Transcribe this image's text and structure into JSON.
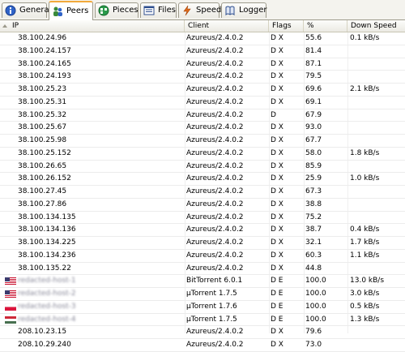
{
  "tabs": [
    {
      "label": "General",
      "icon": "info-icon"
    },
    {
      "label": "Peers",
      "icon": "peers-icon"
    },
    {
      "label": "Pieces",
      "icon": "pieces-icon"
    },
    {
      "label": "Files",
      "icon": "files-icon"
    },
    {
      "label": "Speed",
      "icon": "speed-icon"
    },
    {
      "label": "Logger",
      "icon": "logger-icon"
    }
  ],
  "active_tab": "Peers",
  "columns": {
    "ip": "IP",
    "client": "Client",
    "flags": "Flags",
    "pct": "%",
    "down": "Down Speed"
  },
  "peers": [
    {
      "ip": "38.100.24.96",
      "client": "Azureus/2.4.0.2",
      "flags": "D X",
      "pct": "55.6",
      "down": "0.1 kB/s"
    },
    {
      "ip": "38.100.24.157",
      "client": "Azureus/2.4.0.2",
      "flags": "D X",
      "pct": "81.4",
      "down": ""
    },
    {
      "ip": "38.100.24.165",
      "client": "Azureus/2.4.0.2",
      "flags": "D X",
      "pct": "87.1",
      "down": ""
    },
    {
      "ip": "38.100.24.193",
      "client": "Azureus/2.4.0.2",
      "flags": "D X",
      "pct": "79.5",
      "down": ""
    },
    {
      "ip": "38.100.25.23",
      "client": "Azureus/2.4.0.2",
      "flags": "D X",
      "pct": "69.6",
      "down": "2.1 kB/s"
    },
    {
      "ip": "38.100.25.31",
      "client": "Azureus/2.4.0.2",
      "flags": "D X",
      "pct": "69.1",
      "down": ""
    },
    {
      "ip": "38.100.25.32",
      "client": "Azureus/2.4.0.2",
      "flags": "D",
      "pct": "67.9",
      "down": ""
    },
    {
      "ip": "38.100.25.67",
      "client": "Azureus/2.4.0.2",
      "flags": "D X",
      "pct": "93.0",
      "down": ""
    },
    {
      "ip": "38.100.25.98",
      "client": "Azureus/2.4.0.2",
      "flags": "D X",
      "pct": "67.7",
      "down": ""
    },
    {
      "ip": "38.100.25.152",
      "client": "Azureus/2.4.0.2",
      "flags": "D X",
      "pct": "58.0",
      "down": "1.8 kB/s"
    },
    {
      "ip": "38.100.26.65",
      "client": "Azureus/2.4.0.2",
      "flags": "D X",
      "pct": "85.9",
      "down": ""
    },
    {
      "ip": "38.100.26.152",
      "client": "Azureus/2.4.0.2",
      "flags": "D X",
      "pct": "25.9",
      "down": "1.0 kB/s"
    },
    {
      "ip": "38.100.27.45",
      "client": "Azureus/2.4.0.2",
      "flags": "D X",
      "pct": "67.3",
      "down": ""
    },
    {
      "ip": "38.100.27.86",
      "client": "Azureus/2.4.0.2",
      "flags": "D X",
      "pct": "38.8",
      "down": ""
    },
    {
      "ip": "38.100.134.135",
      "client": "Azureus/2.4.0.2",
      "flags": "D X",
      "pct": "75.2",
      "down": ""
    },
    {
      "ip": "38.100.134.136",
      "client": "Azureus/2.4.0.2",
      "flags": "D X",
      "pct": "38.7",
      "down": "0.4 kB/s"
    },
    {
      "ip": "38.100.134.225",
      "client": "Azureus/2.4.0.2",
      "flags": "D X",
      "pct": "32.1",
      "down": "1.7 kB/s"
    },
    {
      "ip": "38.100.134.236",
      "client": "Azureus/2.4.0.2",
      "flags": "D X",
      "pct": "60.3",
      "down": "1.1 kB/s"
    },
    {
      "ip": "38.100.135.22",
      "client": "Azureus/2.4.0.2",
      "flags": "D X",
      "pct": "44.8",
      "down": ""
    },
    {
      "ip": "redacted-host-1",
      "client": "BitTorrent 6.0.1",
      "flags": "D E",
      "pct": "100.0",
      "down": "13.0 kB/s",
      "redacted": true,
      "flag": "us-flag-icon"
    },
    {
      "ip": "redacted-host-2",
      "client": "µTorrent 1.7.5",
      "flags": "D E",
      "pct": "100.0",
      "down": "3.0 kB/s",
      "redacted": true,
      "flag": "us-flag-icon"
    },
    {
      "ip": "redacted-host-3",
      "client": "µTorrent 1.7.6",
      "flags": "D E",
      "pct": "100.0",
      "down": "0.5 kB/s",
      "redacted": true,
      "flag": "pl-flag-icon"
    },
    {
      "ip": "redacted-host-4",
      "client": "µTorrent 1.7.5",
      "flags": "D E",
      "pct": "100.0",
      "down": "1.3 kB/s",
      "redacted": true,
      "flag": "hu-flag-icon"
    },
    {
      "ip": "208.10.23.15",
      "client": "Azureus/2.4.0.2",
      "flags": "D X",
      "pct": "79.6",
      "down": ""
    },
    {
      "ip": "208.10.29.240",
      "client": "Azureus/2.4.0.2",
      "flags": "D X",
      "pct": "73.0",
      "down": ""
    }
  ]
}
